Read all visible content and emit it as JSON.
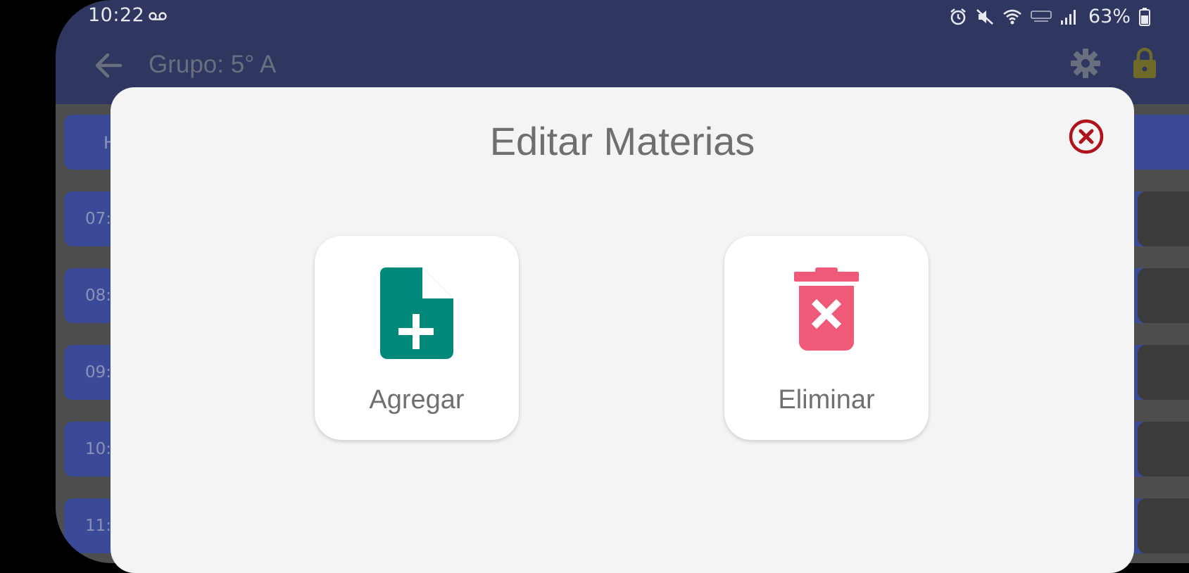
{
  "status_bar": {
    "time": "10:22",
    "battery": "63%"
  },
  "app_bar": {
    "title": "Grupo: 5° A"
  },
  "background": {
    "header_text": "H",
    "rows": [
      "07:",
      "08:",
      "09:",
      "10:",
      "11:"
    ]
  },
  "dialog": {
    "title": "Editar Materias",
    "actions": [
      {
        "label": "Agregar",
        "icon": "add-file-icon",
        "color": "#00897b"
      },
      {
        "label": "Eliminar",
        "icon": "delete-trash-icon",
        "color": "#ee5a78"
      }
    ],
    "close_color": "#b0121b"
  },
  "colors": {
    "app_bar": "#2f3760",
    "row": "#3a4a96",
    "dialog_bg": "#f4f4f4",
    "lock": "#6f6a2a"
  }
}
